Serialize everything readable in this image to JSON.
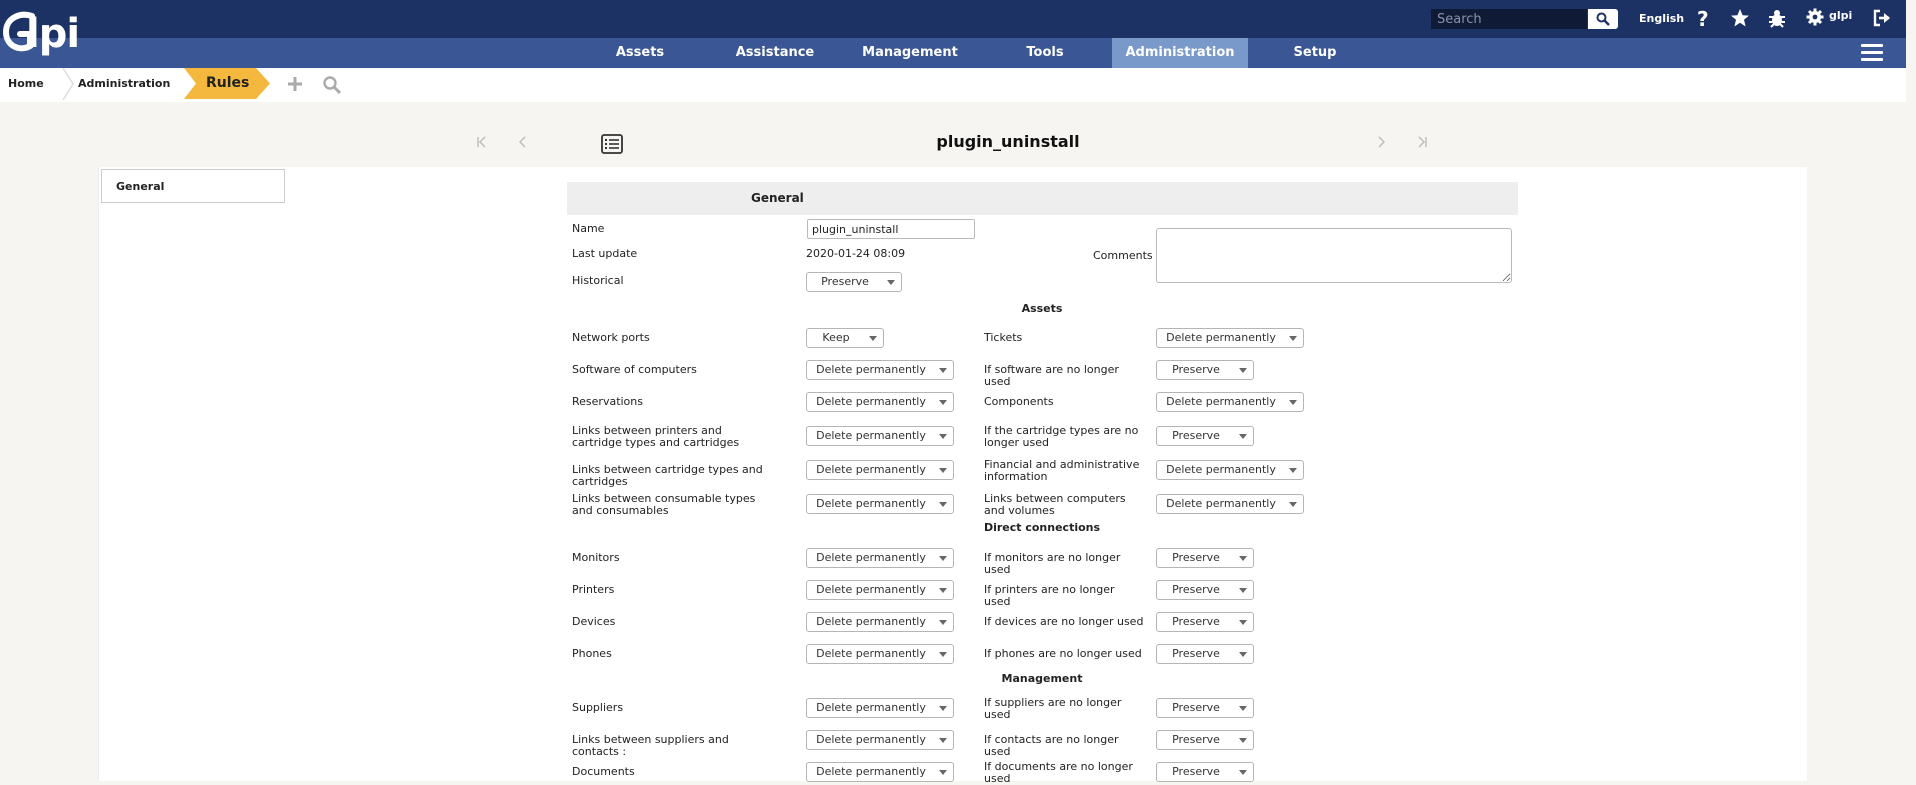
{
  "header": {
    "logo_text": "lpi",
    "search_placeholder": "Search",
    "language": "English",
    "username": "glpi",
    "icons": [
      "help-icon",
      "star-icon",
      "bug-icon",
      "gear-icon",
      "logout-icon",
      "search-icon",
      "hamburger-icon"
    ]
  },
  "menu": [
    "Assets",
    "Assistance",
    "Management",
    "Tools",
    "Administration",
    "Setup"
  ],
  "menu_active": "Administration",
  "breadcrumb": [
    "Home",
    "Administration",
    "Rules"
  ],
  "nav": {
    "title": "plugin_uninstall"
  },
  "tabs": [
    "General"
  ],
  "form": {
    "header": "General",
    "name_label": "Name",
    "name_value": "plugin_uninstall",
    "last_update_label": "Last update",
    "last_update_value": "2020-01-24 08:09",
    "comments_label": "Comments",
    "historical_label": "Historical",
    "historical_value": "Preserve",
    "sections": {
      "assets": "Assets",
      "direct": "Direct connections",
      "management": "Management"
    },
    "rows": [
      {
        "l": "Network ports",
        "lv": "Keep",
        "r": "Tickets",
        "rv": "Delete permanently"
      },
      {
        "l": "Software of computers",
        "lv": "Delete permanently",
        "r": "If software are no longer used",
        "rv": "Preserve"
      },
      {
        "l": "Reservations",
        "lv": "Delete permanently",
        "r": "Components",
        "rv": "Delete permanently"
      },
      {
        "l": "Links between printers and cartridge types and cartridges",
        "lv": "Delete permanently",
        "r": "If the cartridge types are no longer used",
        "rv": "Preserve"
      },
      {
        "l": "Links between cartridge types and cartridges",
        "lv": "Delete permanently",
        "r": "Financial and administrative information",
        "rv": "Delete permanently"
      },
      {
        "l": "Links between consumable types and consumables",
        "lv": "Delete permanently",
        "r": "Links between computers and volumes",
        "rv": "Delete permanently"
      },
      {
        "l": "Monitors",
        "lv": "Delete permanently",
        "r": "If monitors are no longer used",
        "rv": "Preserve"
      },
      {
        "l": "Printers",
        "lv": "Delete permanently",
        "r": "If printers are no longer used",
        "rv": "Preserve"
      },
      {
        "l": "Devices",
        "lv": "Delete permanently",
        "r": "If devices are no longer used",
        "rv": "Preserve"
      },
      {
        "l": "Phones",
        "lv": "Delete permanently",
        "r": "If phones are no longer used",
        "rv": "Preserve"
      },
      {
        "l": "Suppliers",
        "lv": "Delete permanently",
        "r": "If suppliers are no longer used",
        "rv": "Preserve"
      },
      {
        "l": "Links between suppliers and contacts :",
        "lv": "Delete permanently",
        "r": "If contacts are no longer used",
        "rv": "Preserve"
      },
      {
        "l": "Documents",
        "lv": "Delete permanently",
        "r": "If documents are no longer used",
        "rv": "Preserve"
      }
    ]
  }
}
